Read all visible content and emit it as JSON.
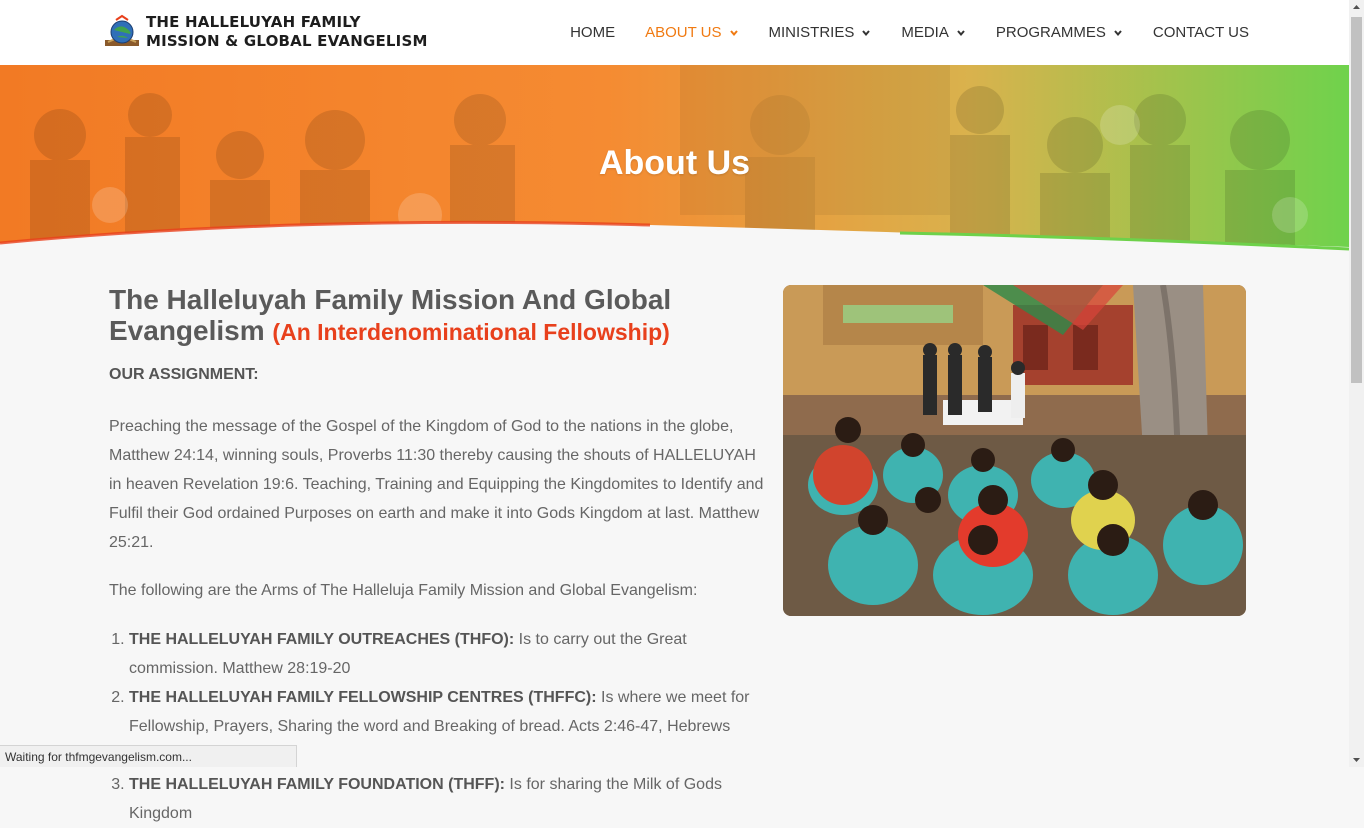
{
  "brand": {
    "line1": "THE HALLELUYAH FAMILY",
    "line2": "MISSION & GLOBAL EVANGELISM"
  },
  "nav": {
    "home": "HOME",
    "about": "ABOUT US",
    "ministries": "MINISTRIES",
    "media": "MEDIA",
    "programmes": "PROGRAMMES",
    "contact": "CONTACT US",
    "active_color": "#f07a12"
  },
  "hero": {
    "title": "About Us"
  },
  "content": {
    "heading_main": "The Halleluyah Family Mission And Global Evangelism",
    "heading_accent": "(An Interdenominational Fellowship)",
    "assignment_label": "OUR ASSIGNMENT:",
    "assignment_text": "Preaching the message of the Gospel of the Kingdom of God to the nations in the globe, Matthew 24:14, winning souls, Proverbs 11:30 thereby causing the shouts of HALLELUYAH in heaven Revelation 19:6. Teaching, Training and Equipping the Kingdomites to Identify and Fulfil their God ordained Purposes on earth and make it into Gods Kingdom at last. Matthew 25:21.",
    "arms_intro": "The following are the Arms of The Halleluja Family Mission and Global Evangelism:",
    "arms": [
      {
        "title": "THE HALLELUYAH FAMILY OUTREACHES (THFO):",
        "text": " Is to carry out the Great commission. Matthew 28:19-20"
      },
      {
        "title": "THE HALLELUYAH FAMILY FELLOWSHIP CENTRES (THFFC):",
        "text": " Is where we meet for Fellowship, Prayers, Sharing the word and Breaking of bread. Acts 2:46-47, Hebrews 10:25."
      },
      {
        "title": "THE HALLELUYAH FAMILY FOUNDATION (THFF):",
        "text": " Is for sharing the Milk of Gods Kingdom"
      }
    ]
  },
  "status": {
    "text": "Waiting for thfmgevangelism.com..."
  },
  "colors": {
    "accent_red": "#e8401c",
    "hero_orange": "#f47a20",
    "hero_green": "#6ed14a"
  }
}
